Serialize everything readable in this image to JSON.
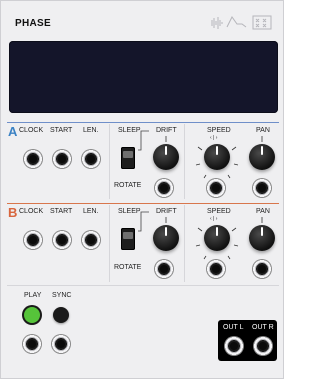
{
  "module": {
    "title": "PHASE"
  },
  "row_a": {
    "letter": "A",
    "letter_color": "#3b82c4",
    "clock": "CLOCK",
    "start": "START",
    "len": "LEN.",
    "sleep": "SLEEP",
    "drift": "DRIFT",
    "rotate": "ROTATE",
    "speed": "SPEED",
    "pan": "PAN",
    "speed_scale": "‹ | ›"
  },
  "row_b": {
    "letter": "B",
    "letter_color": "#d8663e",
    "clock": "CLOCK",
    "start": "START",
    "len": "LEN.",
    "sleep": "SLEEP",
    "drift": "DRIFT",
    "rotate": "ROTATE",
    "speed": "SPEED",
    "pan": "PAN",
    "speed_scale": "‹ | ›"
  },
  "controls": {
    "play": "PLAY",
    "sync": "SYNC",
    "play_color": "#56c43a"
  },
  "outputs": {
    "out_l": "OUT L",
    "out_r": "OUT R"
  },
  "colors": {
    "panel": "#efeff1",
    "screen": "#14152a",
    "divider_a": "#6f8fc9",
    "divider_b": "#d8764c"
  },
  "icons": {
    "brand": "waveform-logo-icon"
  }
}
